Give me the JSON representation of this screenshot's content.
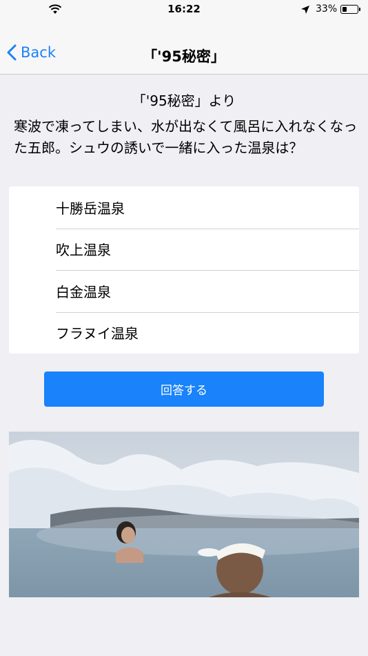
{
  "status_bar": {
    "time": "16:22",
    "battery_percent": "33%",
    "battery_level": 0.33,
    "icons": [
      "wifi-icon",
      "location-icon",
      "battery-icon"
    ]
  },
  "nav": {
    "back_label": "Back",
    "title": "「'95秘密」"
  },
  "quiz": {
    "source": "「'95秘密」より",
    "question": "寒波で凍ってしまい、水が出なくて風呂に入れなくなった五郎。シュウの誘いで一緒に入った温泉は？",
    "choices": [
      "十勝岳温泉",
      "吹上温泉",
      "白金温泉",
      "フラヌイ温泉"
    ],
    "answer_label": "回答する"
  },
  "colors": {
    "accent": "#1a82fb",
    "background": "#efeff4",
    "bar": "#f7f7f7"
  }
}
